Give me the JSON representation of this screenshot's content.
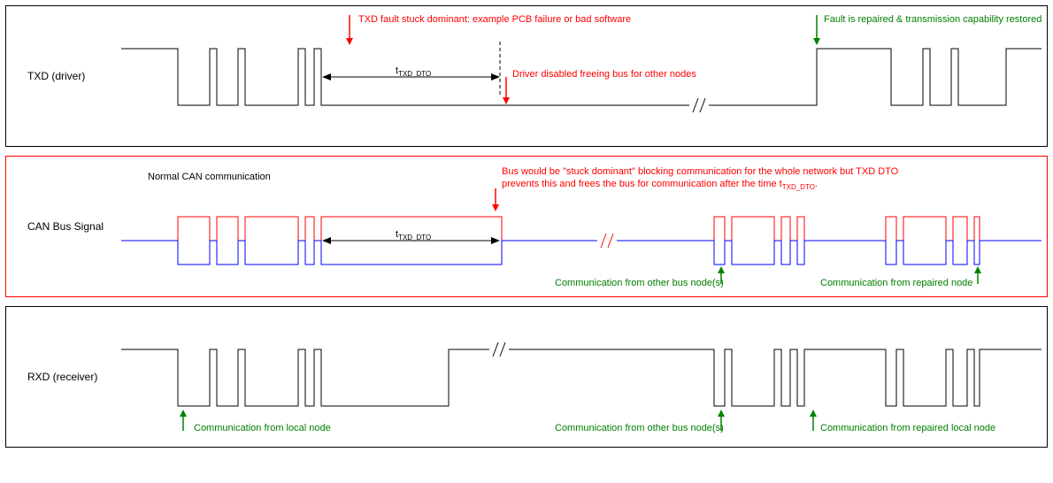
{
  "panel1": {
    "label": "TXD (driver)",
    "fault_text": "TXD fault stuck dominant: example PCB failure or bad software",
    "repair_text": "Fault is repaired & transmission capability restored",
    "disabled_text": "Driver disabled freeing bus for other nodes",
    "t_label": "t",
    "t_sub": "TXD_DTO"
  },
  "panel2": {
    "label": "CAN Bus Signal",
    "normal_text": "Normal CAN communication",
    "bus_text1": "Bus would be \"stuck dominant\" blocking communication for the whole network but TXD DTO",
    "bus_text2": "prevents this and frees the bus for communication after the time t",
    "bus_text2_sub": "TXD_DTO",
    "bus_text2_after": ".",
    "t_label": "t",
    "t_sub": "TXD_DTO",
    "comm_other": "Communication from other bus node(s)",
    "comm_repaired": "Communication from repaired node"
  },
  "panel3": {
    "label": "RXD (receiver)",
    "comm_local": "Communication from local node",
    "comm_other": "Communication from other bus node(s)",
    "comm_repaired": "Communication from repaired local node"
  }
}
